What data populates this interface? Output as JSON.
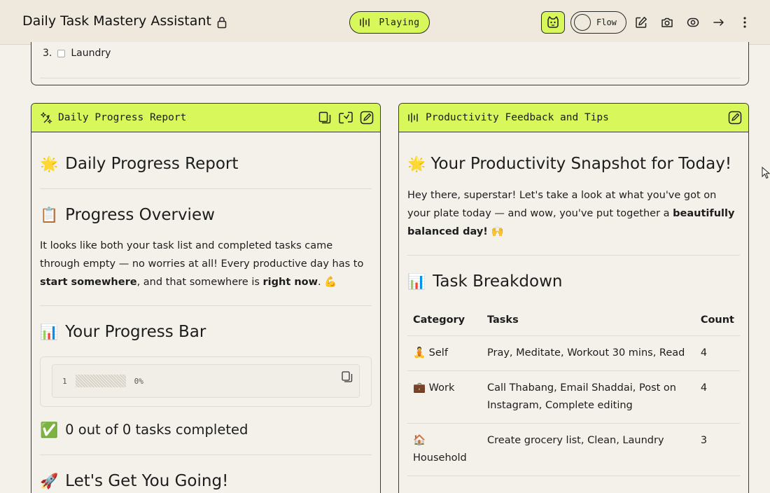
{
  "app": {
    "title": "Daily Task Mastery Assistant",
    "status": "Playing",
    "flow_label": "Flow"
  },
  "top_card": {
    "item_number": "3.",
    "item_label": "Laundry"
  },
  "left_panel": {
    "header": "Daily Progress Report",
    "title_emoji": "🌟",
    "title": "Daily Progress Report",
    "overview_emoji": "📋",
    "overview_heading": "Progress Overview",
    "overview_p1": "It looks like both your task list and completed tasks came through empty — no worries at all! Every productive day has to ",
    "overview_b1": "start somewhere",
    "overview_p2": ", and that somewhere is ",
    "overview_b2": "right now",
    "overview_p3": ". 💪",
    "bar_emoji": "📊",
    "bar_heading": "Your Progress Bar",
    "code_line_number": "1",
    "code_percent": "0%",
    "done_emoji": "✅",
    "done_text": "0 out of 0 tasks completed",
    "next_emoji": "🚀",
    "next_heading": "Let's Get You Going!"
  },
  "right_panel": {
    "header": "Productivity Feedback and Tips",
    "title_emoji": "🌟",
    "title": "Your Productivity Snapshot for Today!",
    "intro_p1": "Hey there, superstar! Let's take a look at what you've got on your plate today — and wow, you've put together a ",
    "intro_b1": "beautifully balanced day!",
    "intro_p2": " 🙌",
    "breakdown_emoji": "📊",
    "breakdown_heading": "Task Breakdown",
    "table": {
      "headers": [
        "Category",
        "Tasks",
        "Count"
      ],
      "rows": [
        {
          "emoji": "🧘",
          "category": "Self",
          "tasks": "Pray, Meditate, Workout 30 mins, Read",
          "count": "4"
        },
        {
          "emoji": "💼",
          "category": "Work",
          "tasks": "Call Thabang, Email Shaddai, Post on Instagram, Complete editing",
          "count": "4"
        },
        {
          "emoji": "🏠",
          "category": "Household",
          "tasks": "Create grocery list, Clean, Laundry",
          "count": "3"
        }
      ]
    }
  },
  "colors": {
    "accent": "#d8f75a",
    "background": "#f4f1ea",
    "topbar": "#efe9dd",
    "border": "#3a3a3a"
  },
  "icons": {
    "topbar": [
      "lock-icon",
      "waveform-icon",
      "bot-icon",
      "edit-icon",
      "camera-icon",
      "eye-icon",
      "share-arrow-icon",
      "more-vertical-icon"
    ],
    "left_header": [
      "sparkle-icon",
      "copy-icon",
      "refresh-icon",
      "edit-icon"
    ],
    "right_header": [
      "waveform-icon",
      "edit-icon"
    ]
  }
}
